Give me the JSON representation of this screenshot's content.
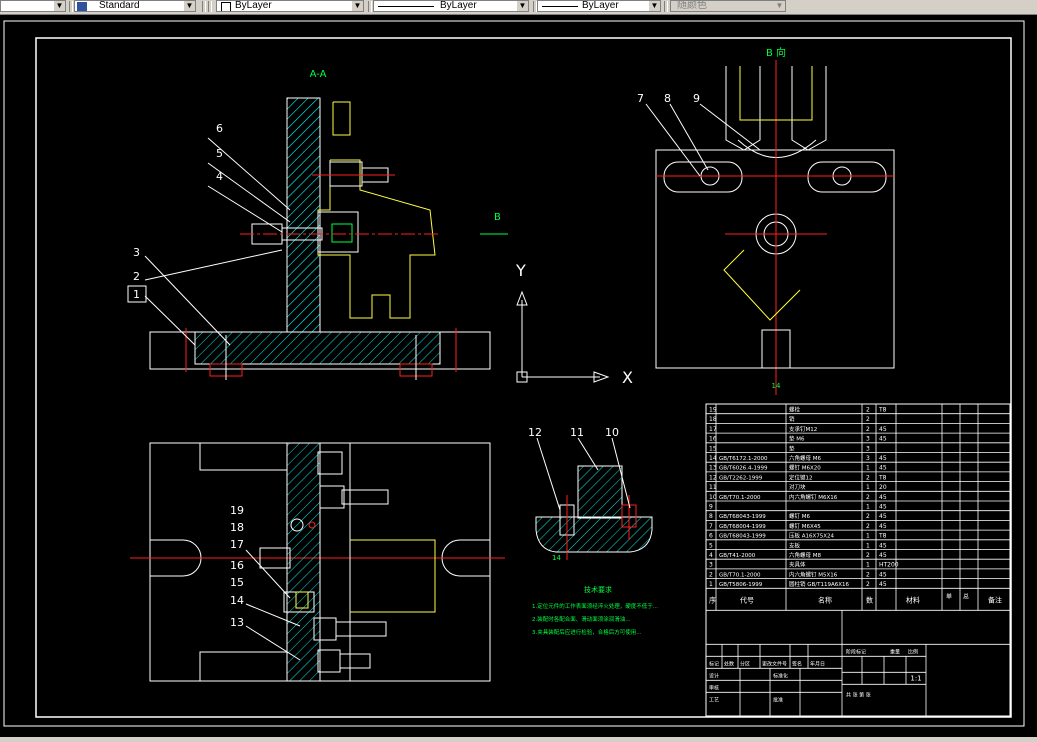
{
  "toolbar": {
    "textstyle_label": "Standard",
    "layer_label": "ByLayer",
    "linetype_label": "ByLayer",
    "lineweight_label": "ByLayer",
    "color_label": "随颜色"
  },
  "drawing": {
    "section_aa": "A-A",
    "view_b": "B 向",
    "arrow_b": "B",
    "axis_y": "Y",
    "axis_x": "X",
    "callouts_main": [
      "6",
      "5",
      "4",
      "3",
      "2",
      "1"
    ],
    "callouts_b": [
      "7",
      "8",
      "9"
    ],
    "callouts_plan": [
      "19",
      "18",
      "17",
      "16",
      "15",
      "14",
      "13"
    ],
    "callouts_detail": [
      "12",
      "11",
      "10"
    ],
    "tech_req_title": "技术要求",
    "tech_req_lines": [
      "1.定位元件的工作表面须经淬火处理，硬度不低于...",
      "2.装配时各配合面、滑动面须涂润滑油...",
      "3.夹具装配后应进行检验，合格后方可使用..."
    ]
  },
  "bom": {
    "rows": [
      {
        "no": "19",
        "code": "",
        "name": "螺栓",
        "qty": "2",
        "mat": "T8"
      },
      {
        "no": "18",
        "code": "",
        "name": "销",
        "qty": "2",
        "mat": ""
      },
      {
        "no": "17",
        "code": "",
        "name": "支承钉M12",
        "qty": "2",
        "mat": "45"
      },
      {
        "no": "16",
        "code": "",
        "name": "垫 M6",
        "qty": "3",
        "mat": "45"
      },
      {
        "no": "15",
        "code": "",
        "name": "垫",
        "qty": "3",
        "mat": ""
      },
      {
        "no": "14",
        "code": "GB/T6172.1-2000",
        "name": "六角螺母 M6",
        "qty": "3",
        "mat": "45"
      },
      {
        "no": "13",
        "code": "GB/T6026.4-1999",
        "name": "螺钉 M6X20",
        "qty": "1",
        "mat": "45"
      },
      {
        "no": "12",
        "code": "GB/T2262-1999",
        "name": "定位键12",
        "qty": "2",
        "mat": "T8"
      },
      {
        "no": "11",
        "code": "",
        "name": "对刀块",
        "qty": "1",
        "mat": "20"
      },
      {
        "no": "10",
        "code": "GB/T70.1-2000",
        "name": "内六角螺钉 M6X16",
        "qty": "2",
        "mat": "45"
      },
      {
        "no": "9",
        "code": "",
        "name": "",
        "qty": "1",
        "mat": "45"
      },
      {
        "no": "8",
        "code": "GB/T68043-1999",
        "name": "螺钉 M6",
        "qty": "2",
        "mat": "45"
      },
      {
        "no": "7",
        "code": "GB/T68004-1999",
        "name": "螺钉 M6X45",
        "qty": "2",
        "mat": "45"
      },
      {
        "no": "6",
        "code": "GB/T68043-1999",
        "name": "压板 A16X75X24",
        "qty": "1",
        "mat": "T8"
      },
      {
        "no": "5",
        "code": "",
        "name": "支板",
        "qty": "1",
        "mat": "45"
      },
      {
        "no": "4",
        "code": "GB/T41-2000",
        "name": "六角螺母 M8",
        "qty": "2",
        "mat": "45"
      },
      {
        "no": "3",
        "code": "",
        "name": "夹具体",
        "qty": "1",
        "mat": "HT200"
      },
      {
        "no": "2",
        "code": "GB/T70.1-2000",
        "name": "内六角螺钉 M5X16",
        "qty": "2",
        "mat": "45"
      },
      {
        "no": "1",
        "code": "GB/T5806-1999",
        "name": "圆柱销 GB/T119A6X16",
        "qty": "2",
        "mat": "45"
      }
    ],
    "header": {
      "no": "序",
      "code": "代号",
      "name": "名称",
      "qty": "数",
      "mat": "材料",
      "w1": "单",
      "w2": "总",
      "note": "备注"
    },
    "title_block": {
      "labels_left": [
        "标记",
        "处数",
        "分区",
        "更改文件号",
        "签名",
        "年月日"
      ],
      "design": "设计",
      "standard": "标准化",
      "review": "审核",
      "craft": "工艺",
      "stage": "阶段标记",
      "weight": "重量",
      "scale": "比例",
      "scale_value": "1:1",
      "sheet": "共 张 第 张",
      "approve": "批准"
    }
  },
  "colors": {
    "white": "#ffffff",
    "red": "#ff2020",
    "cyan": "#00e5e5",
    "yellow": "#ffff40",
    "green": "#00ff40",
    "magenta": "#ff40ff"
  }
}
